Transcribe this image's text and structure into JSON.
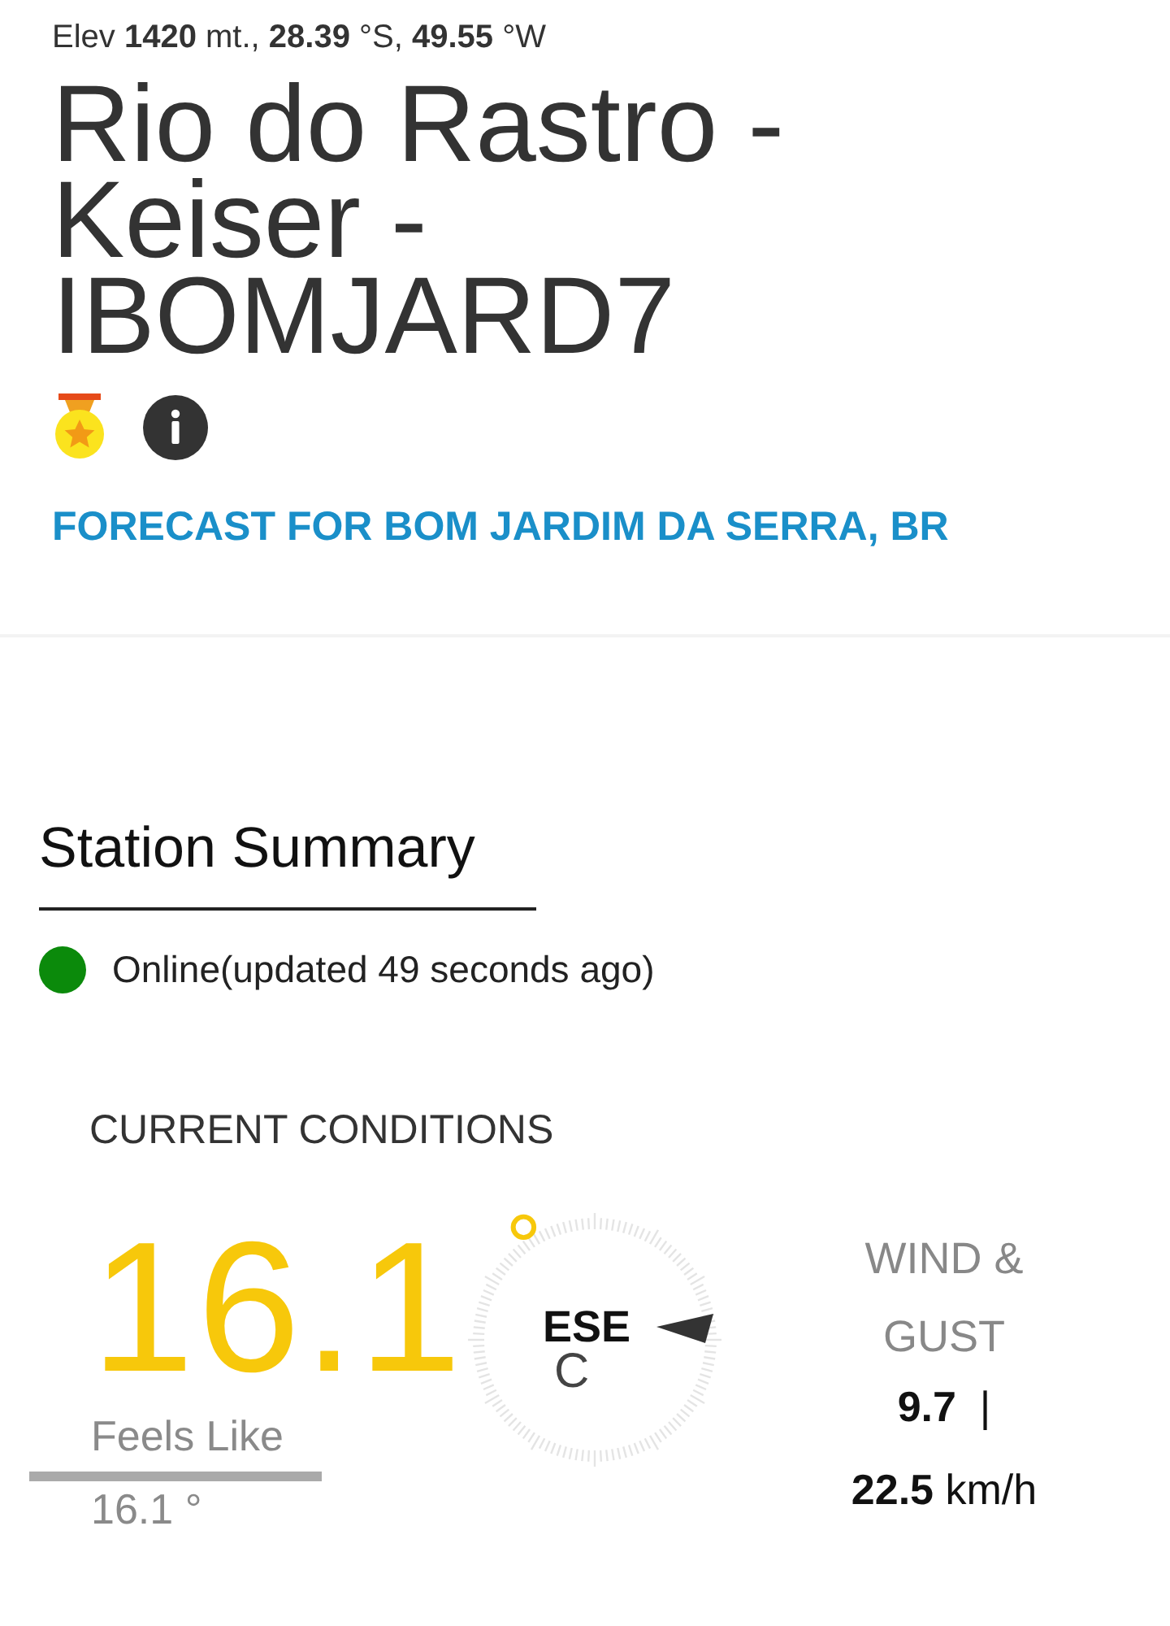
{
  "header": {
    "elevation": "Elev **1420** mt., **28.39** °S, **49.55** °W",
    "title": "Rio do Rastro - Keiser - IBOMJARD7",
    "badges": [
      {
        "kind": "medal"
      },
      {
        "kind": "info"
      }
    ],
    "forecast_link": "FORECAST FOR BOM JARDIM DA SERRA, BR"
  },
  "summary": {
    "heading": "Station Summary",
    "status": {
      "color": "#0b8a0b",
      "text": "Online(updated 49 seconds ago)"
    }
  },
  "conditions": {
    "heading": "CURRENT CONDITIONS",
    "temperature": "16.1",
    "degree": "°",
    "unit": "C",
    "feels_like_label": "Feels Like",
    "feels_like": "16.1 °",
    "wind_direction": "ESE",
    "wind_label": "WIND & GUST",
    "wind_speed": "9.7",
    "separator": "|",
    "gust": "22.5",
    "wind_unit": "km/h"
  }
}
